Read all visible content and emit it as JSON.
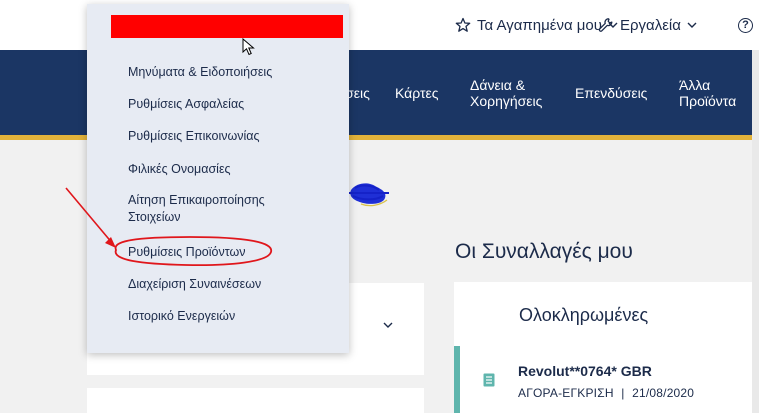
{
  "topbar": {
    "favorites_label": "Τα Αγαπημένα μου",
    "tools_label": "Εργαλεία",
    "help_glyph": "?"
  },
  "nav": {
    "items": [
      {
        "label": "ίσεις"
      },
      {
        "label": "Κάρτες"
      },
      {
        "label": "Δάνεια &\nΧορηγήσεις"
      },
      {
        "label": "Επενδύσεις"
      },
      {
        "label": "Άλλα\nΠροϊόντα"
      }
    ]
  },
  "dropdown": {
    "items": [
      {
        "label": "Μηνύματα & Ειδοποιήσεις"
      },
      {
        "label": "Ρυθμίσεις Ασφαλείας"
      },
      {
        "label": "Ρυθμίσεις Επικοινωνίας"
      },
      {
        "label": "Φιλικές Ονομασίες"
      },
      {
        "label": "Αίτηση Επικαιροποίησης\nΣτοιχείων"
      },
      {
        "label": "Ρυθμίσεις Προϊόντων"
      },
      {
        "label": "Διαχείριση Συναινέσεων"
      },
      {
        "label": "Ιστορικό Ενεργειών"
      }
    ]
  },
  "transactions": {
    "title": "Οι Συναλλαγές μου",
    "completed_label": "Ολοκληρωμένες",
    "items": [
      {
        "name": "Revolut**0764* GBR",
        "type": "ΑΓΟΡΑ-ΕΓΚΡΙΣΗ",
        "date": "21/08/2020"
      }
    ]
  },
  "colors": {
    "navy": "#1b3664",
    "gold": "#e2b23a",
    "teal": "#5fb5ad",
    "annotation_red": "#e0161b",
    "redaction": "#ff0000"
  }
}
